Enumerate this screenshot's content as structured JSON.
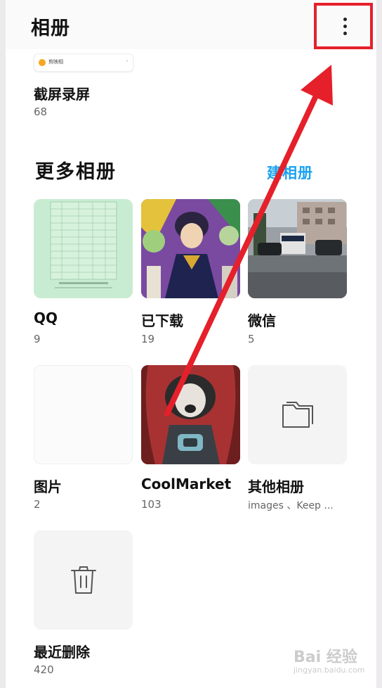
{
  "header": {
    "title": "相册"
  },
  "recent_strip": {
    "text": "剪映相"
  },
  "screenshot_album": {
    "label": "截屏录屏",
    "count": "68"
  },
  "more_section": {
    "title": "更多相册",
    "new_album_label": "建相册"
  },
  "albums": [
    {
      "label": "QQ",
      "count": "9"
    },
    {
      "label": "已下载",
      "count": "19"
    },
    {
      "label": "微信",
      "count": "5"
    },
    {
      "label": "图片",
      "count": "2"
    },
    {
      "label": "CoolMarket",
      "count": "103"
    },
    {
      "label": "其他相册",
      "count": "images 、Keep ..."
    },
    {
      "label": "最近删除",
      "count": "420"
    }
  ],
  "watermark": {
    "text": "Bai 经验",
    "sub": "jingyan.baidu.com"
  },
  "colors": {
    "highlight": "#e5202a",
    "accent": "#1aa2f0"
  }
}
